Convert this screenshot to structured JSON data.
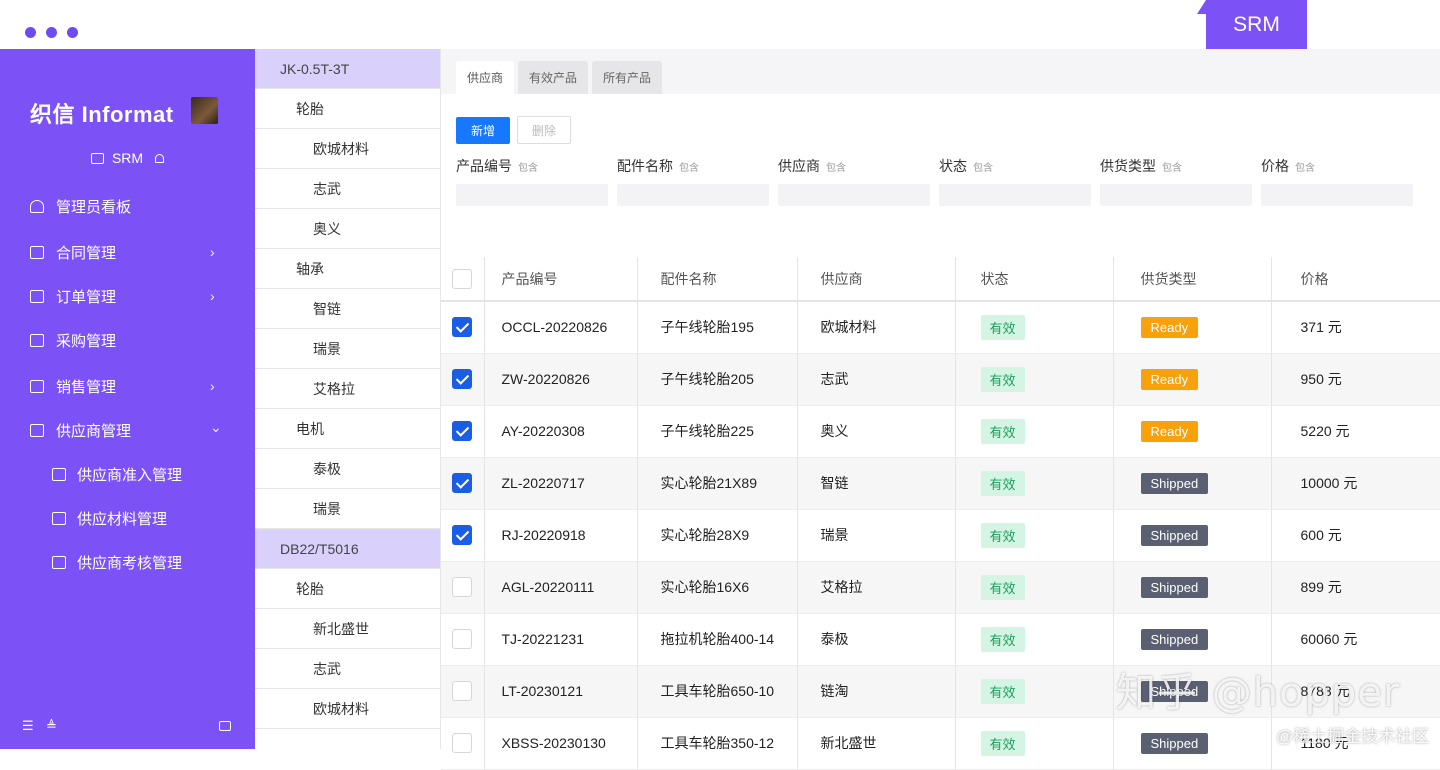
{
  "header": {
    "badge": "SRM"
  },
  "sidebar": {
    "brand": "织信 Informat",
    "app_name": "SRM",
    "items": [
      {
        "label": "管理员看板",
        "icon": "user-icon"
      },
      {
        "label": "合同管理",
        "icon": "document-icon",
        "chevron": "›"
      },
      {
        "label": "订单管理",
        "icon": "grid-icon",
        "chevron": "›"
      },
      {
        "label": "采购管理",
        "icon": "grid-icon"
      },
      {
        "label": "销售管理",
        "icon": "grid-icon",
        "chevron": "›"
      },
      {
        "label": "供应商管理",
        "icon": "grid-icon",
        "chevron": "⌄"
      },
      {
        "label": "供应商准入管理",
        "icon": "grid-icon"
      },
      {
        "label": "供应材料管理",
        "icon": "grid-icon"
      },
      {
        "label": "供应商考核管理",
        "icon": "grid-icon"
      }
    ],
    "footer": {
      "left1": "☰",
      "left2": "≜"
    }
  },
  "tree": [
    {
      "label": "JK-0.5T-3T",
      "level": 0
    },
    {
      "label": "轮胎",
      "level": 1
    },
    {
      "label": "欧城材料",
      "level": 2
    },
    {
      "label": "志武",
      "level": 2
    },
    {
      "label": "奥义",
      "level": 2
    },
    {
      "label": "轴承",
      "level": 1
    },
    {
      "label": "智链",
      "level": 2
    },
    {
      "label": "瑞景",
      "level": 2
    },
    {
      "label": "艾格拉",
      "level": 2
    },
    {
      "label": "电机",
      "level": 1
    },
    {
      "label": "泰极",
      "level": 2
    },
    {
      "label": "瑞景",
      "level": 2
    },
    {
      "label": "DB22/T5016",
      "level": 0
    },
    {
      "label": "轮胎",
      "level": 1
    },
    {
      "label": "新北盛世",
      "level": 2
    },
    {
      "label": "志武",
      "level": 2
    },
    {
      "label": "欧城材料",
      "level": 2
    }
  ],
  "tabs": [
    "供应商",
    "有效产品",
    "所有产品"
  ],
  "toolbar": {
    "new_label": "新增",
    "delete_label": "删除"
  },
  "filters": [
    {
      "label": "产品编号",
      "mode": "包含"
    },
    {
      "label": "配件名称",
      "mode": "包含"
    },
    {
      "label": "供应商",
      "mode": "包含"
    },
    {
      "label": "状态",
      "mode": "包含"
    },
    {
      "label": "供货类型",
      "mode": "包含"
    },
    {
      "label": "价格",
      "mode": "包含"
    }
  ],
  "table": {
    "columns": [
      "产品编号",
      "配件名称",
      "供应商",
      "状态",
      "供货类型",
      "价格"
    ],
    "rows": [
      {
        "checked": true,
        "code": "OCCL-20220826",
        "part": "子午线轮胎195",
        "supplier": "欧城材料",
        "status": "有效",
        "supply": "Ready",
        "price": "371 元"
      },
      {
        "checked": true,
        "code": "ZW-20220826",
        "part": "子午线轮胎205",
        "supplier": "志武",
        "status": "有效",
        "supply": "Ready",
        "price": "950 元"
      },
      {
        "checked": true,
        "code": "AY-20220308",
        "part": "子午线轮胎225",
        "supplier": "奥义",
        "status": "有效",
        "supply": "Ready",
        "price": "5220 元"
      },
      {
        "checked": true,
        "code": "ZL-20220717",
        "part": "实心轮胎21X89",
        "supplier": "智链",
        "status": "有效",
        "supply": "Shipped",
        "price": "10000 元"
      },
      {
        "checked": true,
        "code": "RJ-20220918",
        "part": "实心轮胎28X9",
        "supplier": "瑞景",
        "status": "有效",
        "supply": "Shipped",
        "price": "600 元"
      },
      {
        "checked": false,
        "code": "AGL-20220111",
        "part": "实心轮胎16X6",
        "supplier": "艾格拉",
        "status": "有效",
        "supply": "Shipped",
        "price": "899 元"
      },
      {
        "checked": false,
        "code": "TJ-20221231",
        "part": "拖拉机轮胎400-14",
        "supplier": "泰极",
        "status": "有效",
        "supply": "Shipped",
        "price": "60060 元"
      },
      {
        "checked": false,
        "code": "LT-20230121",
        "part": "工具车轮胎650-10",
        "supplier": "链淘",
        "status": "有效",
        "supply": "Shipped",
        "price": "8788 元"
      },
      {
        "checked": false,
        "code": "XBSS-20230130",
        "part": "工具车轮胎350-12",
        "supplier": "新北盛世",
        "status": "有效",
        "supply": "Shipped",
        "price": "1180 元"
      }
    ]
  },
  "watermark": {
    "main": "知乎 @hopper",
    "sub": "@稀土掘金技术社区"
  },
  "colors": {
    "accent": "#7c52f7",
    "primary_button": "#1677ff",
    "ready": "#f7a10c",
    "shipped": "#5a6072",
    "valid_bg": "#d4f5e4"
  }
}
